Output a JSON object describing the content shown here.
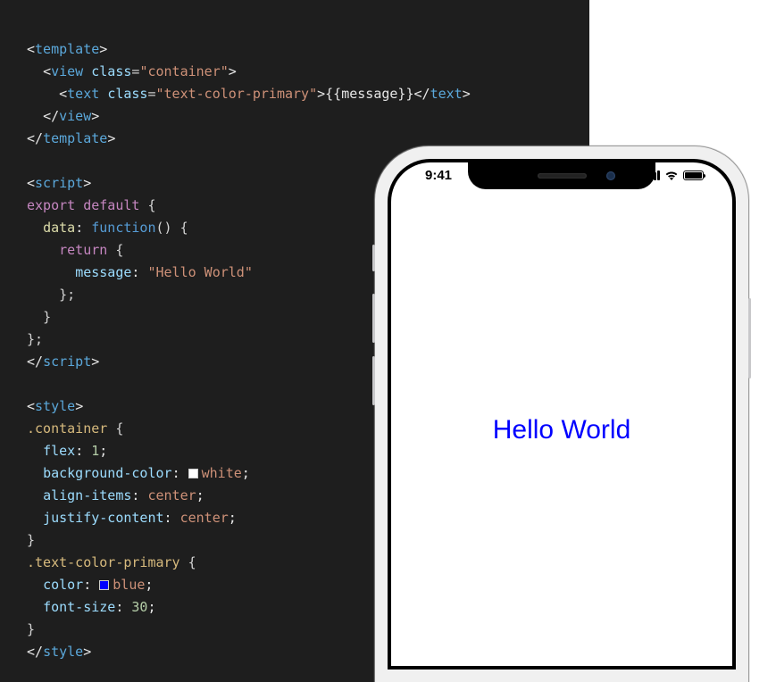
{
  "code": {
    "template_open": "template",
    "template_close": "template",
    "view_tag": "view",
    "view_class_attr": "class",
    "view_class_val": "\"container\"",
    "text_tag": "text",
    "text_class_attr": "class",
    "text_class_val": "\"text-color-primary\"",
    "text_interp": "{{message}}",
    "script_tag": "script",
    "export_kw": "export",
    "default_kw": "default",
    "data_prop": "data",
    "function_kw": "function",
    "return_kw": "return",
    "message_prop": "message",
    "message_val": "\"Hello World\"",
    "style_tag": "style",
    "container_sel": ".container",
    "flex_prop": "flex",
    "flex_val": "1",
    "bg_prop": "background-color",
    "bg_val": "white",
    "align_prop": "align-items",
    "align_val": "center",
    "justify_prop": "justify-content",
    "justify_val": "center",
    "primary_sel": ".text-color-primary",
    "color_prop": "color",
    "color_val": "blue",
    "fontsize_prop": "font-size",
    "fontsize_val": "30"
  },
  "phone": {
    "time": "9:41",
    "message": "Hello World"
  }
}
